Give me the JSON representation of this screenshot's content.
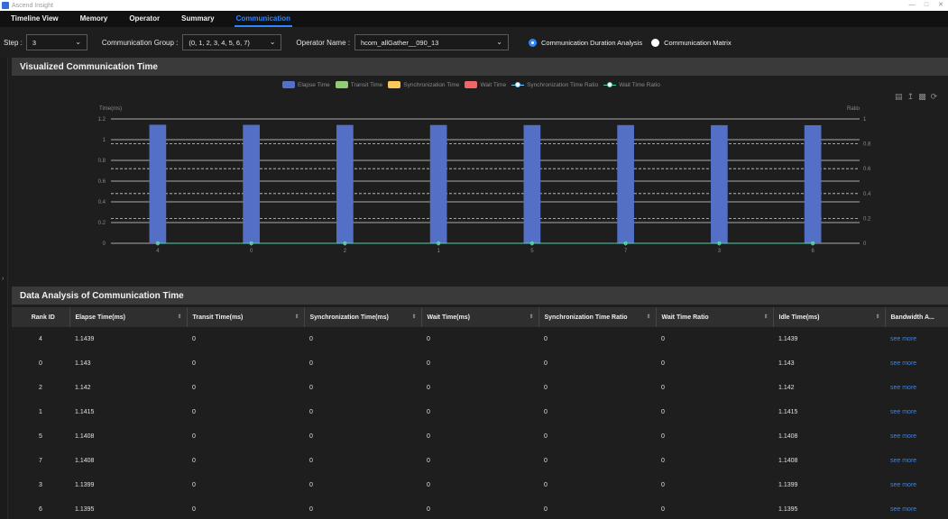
{
  "app": {
    "title": "Ascend Insight",
    "window_buttons": [
      "—",
      "□",
      "✕"
    ]
  },
  "tabs": [
    {
      "label": "Timeline View"
    },
    {
      "label": "Memory"
    },
    {
      "label": "Operator"
    },
    {
      "label": "Summary"
    },
    {
      "label": "Communication",
      "active": true
    }
  ],
  "filters": {
    "step_label": "Step :",
    "step_value": "3",
    "group_label": "Communication Group :",
    "group_value": "(0, 1, 2, 3, 4, 5, 6, 7)",
    "operator_label": "Operator Name :",
    "operator_value": "hcom_allGather__090_13",
    "radio_duration": "Communication Duration Analysis",
    "radio_matrix": "Communication Matrix"
  },
  "sections": {
    "chart_title": "Visualized Communication Time",
    "table_title": "Data Analysis of Communication Time"
  },
  "colors": {
    "elapse": "#5470c6",
    "transit": "#91cc75",
    "sync": "#fac858",
    "wait": "#ee6666",
    "sync_ratio": "#6fd0ff",
    "wait_ratio": "#4fd2a8",
    "accent": "#2f86ff"
  },
  "chart_data": {
    "type": "bar",
    "categories": [
      "4",
      "0",
      "2",
      "1",
      "5",
      "7",
      "3",
      "6"
    ],
    "series": [
      {
        "name": "Elapse Time",
        "type": "bar",
        "values": [
          1.1439,
          1.143,
          1.142,
          1.1415,
          1.1408,
          1.1408,
          1.1399,
          1.1395
        ]
      },
      {
        "name": "Transit Time",
        "type": "bar",
        "values": [
          0,
          0,
          0,
          0,
          0,
          0,
          0,
          0
        ]
      },
      {
        "name": "Synchronization Time",
        "type": "bar",
        "values": [
          0,
          0,
          0,
          0,
          0,
          0,
          0,
          0
        ]
      },
      {
        "name": "Wait Time",
        "type": "bar",
        "values": [
          0,
          0,
          0,
          0,
          0,
          0,
          0,
          0
        ]
      },
      {
        "name": "Synchronization Time Ratio",
        "type": "line",
        "axis": "right",
        "values": [
          0,
          0,
          0,
          0,
          0,
          0,
          0,
          0
        ]
      },
      {
        "name": "Wait Time Ratio",
        "type": "line",
        "axis": "right",
        "values": [
          0,
          0,
          0,
          0,
          0,
          0,
          0,
          0
        ]
      }
    ],
    "ylabel": "Time(ms)",
    "ylabel_right": "Ratio",
    "ylim": [
      0,
      1.2
    ],
    "ylim_right": [
      0,
      1
    ],
    "yticks": [
      "0",
      "0.2",
      "0.4",
      "0.6",
      "0.8",
      "1",
      "1.2"
    ],
    "yticks_right": [
      "0",
      "0.2",
      "0.4",
      "0.6",
      "0.8",
      "1"
    ],
    "legend_position": "top-center"
  },
  "table": {
    "columns": [
      "Rank ID",
      "Elapse Time(ms)",
      "Transit Time(ms)",
      "Synchronization Time(ms)",
      "Wait Time(ms)",
      "Synchronization Time Ratio",
      "Wait Time Ratio",
      "Idle Time(ms)",
      "Bandwidth A..."
    ],
    "rows": [
      [
        "4",
        "1.1439",
        "0",
        "0",
        "0",
        "0",
        "0",
        "1.1439",
        "see more"
      ],
      [
        "0",
        "1.143",
        "0",
        "0",
        "0",
        "0",
        "0",
        "1.143",
        "see more"
      ],
      [
        "2",
        "1.142",
        "0",
        "0",
        "0",
        "0",
        "0",
        "1.142",
        "see more"
      ],
      [
        "1",
        "1.1415",
        "0",
        "0",
        "0",
        "0",
        "0",
        "1.1415",
        "see more"
      ],
      [
        "5",
        "1.1408",
        "0",
        "0",
        "0",
        "0",
        "0",
        "1.1408",
        "see more"
      ],
      [
        "7",
        "1.1408",
        "0",
        "0",
        "0",
        "0",
        "0",
        "1.1408",
        "see more"
      ],
      [
        "3",
        "1.1399",
        "0",
        "0",
        "0",
        "0",
        "0",
        "1.1399",
        "see more"
      ],
      [
        "6",
        "1.1395",
        "0",
        "0",
        "0",
        "0",
        "0",
        "1.1395",
        "see more"
      ]
    ]
  }
}
